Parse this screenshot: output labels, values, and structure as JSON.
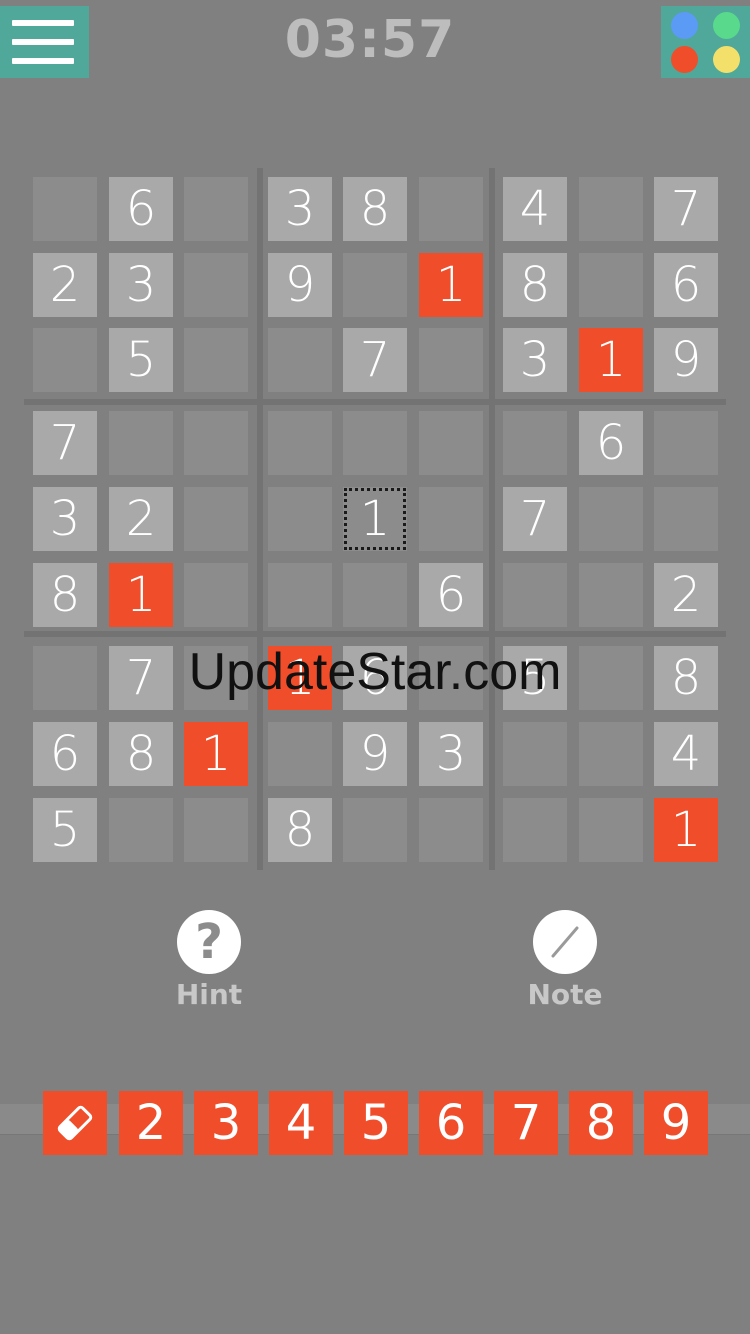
{
  "timer": "03:57",
  "watermark": "UpdateStar.com",
  "theme_colors": [
    "#5b9bf5",
    "#59d98b",
    "#f04d2a",
    "#f3e06a"
  ],
  "colors": {
    "given": "#a9a9a9",
    "empty": "#8c8c8c",
    "error": "#f04d2a",
    "accent": "#4fa89a"
  },
  "board": [
    [
      "",
      "6",
      "",
      "3",
      "8",
      "",
      "4",
      "",
      "7"
    ],
    [
      "2",
      "3",
      "",
      "9",
      "",
      "1",
      "8",
      "",
      "6"
    ],
    [
      "",
      "5",
      "",
      "",
      "7",
      "",
      "3",
      "1",
      "9"
    ],
    [
      "7",
      "",
      "",
      "",
      "",
      "",
      "",
      "6",
      ""
    ],
    [
      "3",
      "2",
      "",
      "",
      "1",
      "",
      "7",
      "",
      ""
    ],
    [
      "8",
      "1",
      "",
      "",
      "",
      "6",
      "",
      "",
      "2"
    ],
    [
      "",
      "7",
      "",
      "1",
      "6",
      "",
      "5",
      "",
      "8"
    ],
    [
      "6",
      "8",
      "1",
      "",
      "9",
      "3",
      "",
      "",
      "4"
    ],
    [
      "5",
      "",
      "",
      "8",
      "",
      "",
      "",
      "",
      "1"
    ]
  ],
  "given": [
    [
      0,
      1,
      0,
      1,
      1,
      0,
      1,
      0,
      1
    ],
    [
      1,
      1,
      0,
      1,
      0,
      0,
      1,
      0,
      1
    ],
    [
      0,
      1,
      0,
      0,
      1,
      0,
      1,
      0,
      1
    ],
    [
      1,
      0,
      0,
      0,
      0,
      0,
      0,
      1,
      0
    ],
    [
      1,
      1,
      0,
      0,
      0,
      0,
      1,
      0,
      0
    ],
    [
      1,
      0,
      0,
      0,
      0,
      1,
      0,
      0,
      1
    ],
    [
      0,
      1,
      0,
      0,
      1,
      0,
      1,
      0,
      1
    ],
    [
      1,
      1,
      0,
      0,
      1,
      1,
      0,
      0,
      1
    ],
    [
      1,
      0,
      0,
      1,
      0,
      0,
      0,
      0,
      0
    ]
  ],
  "errors": [
    [
      1,
      5
    ],
    [
      2,
      7
    ],
    [
      5,
      1
    ],
    [
      6,
      3
    ],
    [
      7,
      2
    ],
    [
      8,
      8
    ]
  ],
  "selected": [
    4,
    4
  ],
  "tools": {
    "hint_label": "Hint",
    "note_label": "Note"
  },
  "keypad": [
    "eraser",
    "2",
    "3",
    "4",
    "5",
    "6",
    "7",
    "8",
    "9"
  ]
}
